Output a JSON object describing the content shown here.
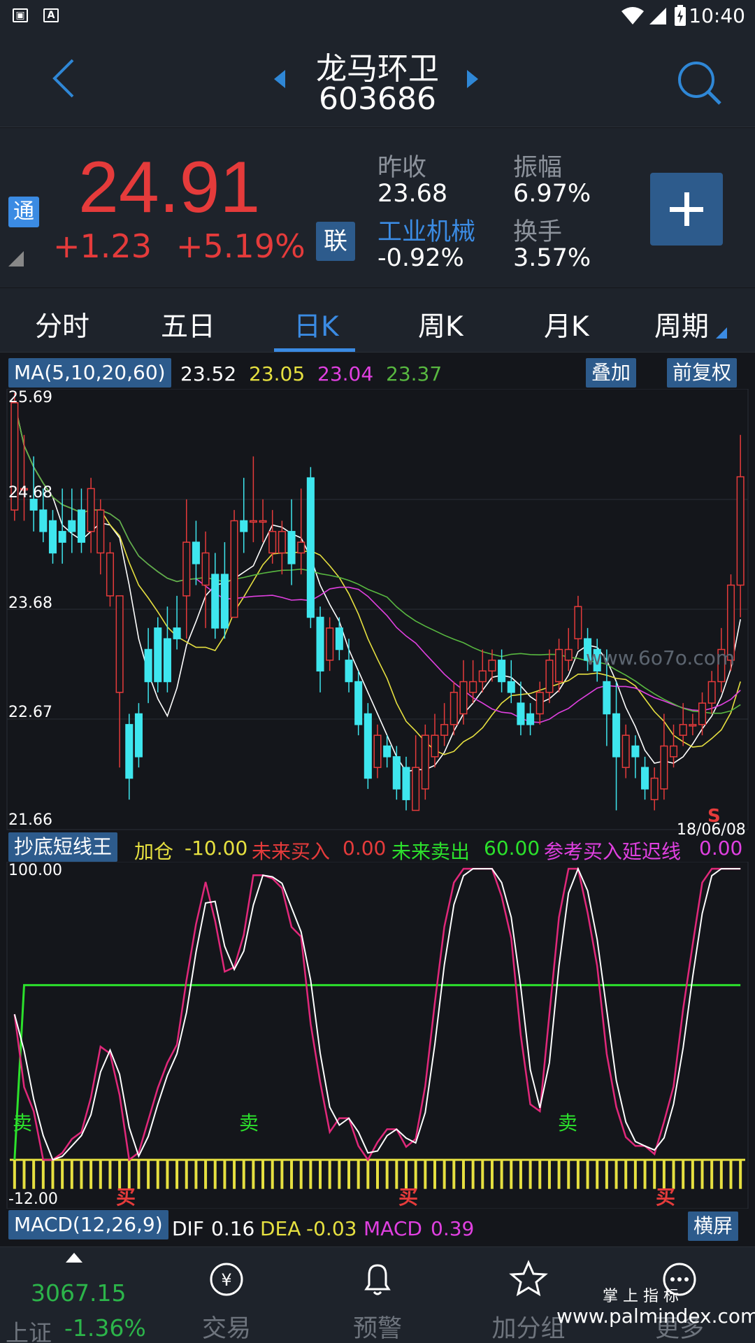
{
  "status": {
    "time": "10:40"
  },
  "header": {
    "name": "龙马环卫",
    "code": "603686"
  },
  "quote": {
    "price": "24.91",
    "change": "+1.23",
    "change_pct": "+5.19%",
    "tong": "通",
    "lian": "联",
    "prev_close_label": "昨收",
    "prev_close": "23.68",
    "amplitude_label": "振幅",
    "amplitude": "6.97%",
    "industry": "工业机械",
    "industry_pct": "-0.92%",
    "turnover_label": "换手",
    "turnover": "3.57%"
  },
  "tabs": [
    "分时",
    "五日",
    "日K",
    "周K",
    "月K",
    "周期"
  ],
  "ma": {
    "label": "MA(5,10,20,60)",
    "ma5": "23.52",
    "ma10": "23.05",
    "ma20": "23.04",
    "ma60": "23.37",
    "overlay": "叠加",
    "adjust": "前复权"
  },
  "kchart": {
    "ymax": "25.69",
    "y2": "24.68",
    "y3": "23.68",
    "y4": "22.67",
    "ymin": "21.66",
    "date": "18/06/08",
    "s_mark": "S",
    "watermark": "www.6o7o.com",
    "colors": {
      "up": "#e53b3b",
      "down": "#3ee6ee",
      "ma5": "#ffffff",
      "ma10": "#e6e040",
      "ma20": "#e040e0",
      "ma60": "#58b840"
    }
  },
  "indicator": {
    "name": "抄底短线王",
    "f1_label": "加仓",
    "f1_val": "-10.00",
    "f2_label": "未来买入",
    "f2_val": "0.00",
    "f3_label": "未来卖出",
    "f3_val": "60.00",
    "f4_label": "参考买入延迟线",
    "f4_val": "0.00",
    "ymax": "100.00",
    "ymin": "-12.00",
    "sell": "卖",
    "buy": "买"
  },
  "macd": {
    "label": "MACD(12,26,9)",
    "dif_label": "DIF",
    "dif": "0.16",
    "dea_label": "DEA",
    "dea": "-0.03",
    "macd_label": "MACD",
    "macd": "0.39",
    "landscape": "横屏"
  },
  "nav": {
    "index_value": "3067.15",
    "index_market": "上证",
    "index_pct": "-1.36%",
    "trade": "交易",
    "alert": "预警",
    "watchlist": "加分组",
    "more": "更多"
  },
  "watermark2": {
    "line1": "掌 上 指 标",
    "line2": "www.palmindex.com"
  },
  "chart_data": {
    "type": "candlestick",
    "ylim": [
      21.66,
      25.69
    ],
    "candles": [
      [
        24.6,
        25.6,
        24.5,
        25.69
      ],
      [
        24.8,
        24.8,
        24.5,
        25.3
      ],
      [
        24.7,
        24.6,
        24.4,
        25.1
      ],
      [
        24.6,
        24.4,
        24.3,
        24.8
      ],
      [
        24.5,
        24.2,
        24.1,
        24.6
      ],
      [
        24.4,
        24.3,
        24.1,
        24.8
      ],
      [
        24.5,
        24.4,
        24.2,
        24.8
      ],
      [
        24.6,
        24.3,
        24.2,
        24.8
      ],
      [
        24.4,
        24.8,
        24.2,
        24.9
      ],
      [
        24.2,
        24.6,
        24.0,
        24.7
      ],
      [
        23.8,
        24.2,
        23.7,
        24.3
      ],
      [
        22.9,
        23.8,
        22.2,
        23.8
      ],
      [
        22.6,
        22.1,
        21.9,
        22.7
      ],
      [
        22.7,
        22.3,
        22.2,
        22.8
      ],
      [
        23.3,
        23.0,
        22.8,
        23.5
      ],
      [
        23.5,
        23.0,
        22.9,
        23.6
      ],
      [
        23.4,
        23.0,
        22.9,
        23.7
      ],
      [
        23.5,
        23.4,
        23.3,
        23.8
      ],
      [
        23.8,
        24.3,
        23.4,
        24.7
      ],
      [
        24.3,
        24.1,
        23.9,
        24.5
      ],
      [
        23.9,
        24.2,
        23.5,
        24.4
      ],
      [
        24.0,
        23.5,
        23.4,
        24.2
      ],
      [
        24.0,
        23.5,
        23.4,
        24.3
      ],
      [
        23.6,
        24.5,
        23.6,
        24.6
      ],
      [
        24.5,
        24.4,
        24.2,
        24.9
      ],
      [
        24.5,
        24.5,
        24.3,
        25.1
      ],
      [
        24.5,
        24.5,
        24.3,
        24.7
      ],
      [
        24.2,
        24.4,
        24.1,
        24.6
      ],
      [
        24.2,
        24.4,
        24.0,
        24.5
      ],
      [
        24.4,
        24.1,
        23.9,
        24.7
      ],
      [
        24.2,
        24.3,
        24.0,
        24.8
      ],
      [
        24.9,
        23.6,
        23.5,
        25.0
      ],
      [
        23.6,
        23.1,
        22.9,
        23.7
      ],
      [
        23.2,
        23.5,
        23.1,
        23.6
      ],
      [
        23.5,
        23.3,
        23.2,
        23.6
      ],
      [
        23.2,
        23.0,
        22.9,
        23.4
      ],
      [
        23.0,
        22.6,
        22.5,
        23.1
      ],
      [
        22.7,
        22.1,
        22.0,
        22.8
      ],
      [
        22.2,
        22.5,
        22.1,
        22.6
      ],
      [
        22.4,
        22.3,
        22.2,
        22.5
      ],
      [
        22.3,
        22.0,
        21.9,
        22.4
      ],
      [
        22.2,
        21.9,
        21.8,
        22.3
      ],
      [
        21.8,
        22.2,
        21.8,
        22.5
      ],
      [
        22.0,
        22.5,
        21.9,
        22.6
      ],
      [
        22.3,
        22.5,
        22.2,
        22.7
      ],
      [
        22.5,
        22.6,
        22.4,
        22.8
      ],
      [
        22.6,
        22.9,
        22.5,
        23.0
      ],
      [
        22.7,
        23.0,
        22.6,
        23.2
      ],
      [
        22.9,
        23.0,
        22.8,
        23.2
      ],
      [
        23.0,
        23.1,
        22.9,
        23.3
      ],
      [
        23.1,
        23.2,
        23.0,
        23.3
      ],
      [
        23.2,
        23.0,
        22.9,
        23.3
      ],
      [
        23.0,
        22.9,
        22.8,
        23.2
      ],
      [
        22.8,
        22.6,
        22.5,
        23.0
      ],
      [
        22.7,
        22.6,
        22.5,
        22.8
      ],
      [
        22.7,
        22.9,
        22.6,
        23.0
      ],
      [
        22.9,
        23.2,
        22.8,
        23.3
      ],
      [
        23.0,
        23.3,
        22.9,
        23.4
      ],
      [
        23.2,
        23.3,
        23.1,
        23.5
      ],
      [
        23.4,
        23.7,
        23.3,
        23.8
      ],
      [
        23.4,
        23.2,
        23.1,
        23.5
      ],
      [
        23.3,
        23.1,
        23.0,
        23.4
      ],
      [
        23.0,
        22.7,
        22.4,
        23.3
      ],
      [
        22.7,
        22.3,
        21.8,
        23.0
      ],
      [
        22.2,
        22.5,
        22.1,
        22.6
      ],
      [
        22.4,
        22.3,
        22.1,
        22.5
      ],
      [
        22.2,
        22.0,
        21.9,
        22.3
      ],
      [
        21.9,
        22.1,
        21.8,
        22.2
      ],
      [
        22.0,
        22.4,
        21.9,
        22.7
      ],
      [
        22.3,
        22.4,
        22.2,
        22.6
      ],
      [
        22.5,
        22.6,
        22.4,
        22.8
      ],
      [
        22.6,
        22.6,
        22.5,
        22.7
      ],
      [
        22.6,
        22.8,
        22.5,
        22.9
      ],
      [
        22.8,
        23.0,
        22.7,
        23.1
      ],
      [
        23.0,
        23.3,
        22.9,
        23.5
      ],
      [
        23.2,
        23.9,
        23.1,
        24.0
      ],
      [
        23.9,
        24.91,
        23.6,
        25.3
      ]
    ]
  }
}
